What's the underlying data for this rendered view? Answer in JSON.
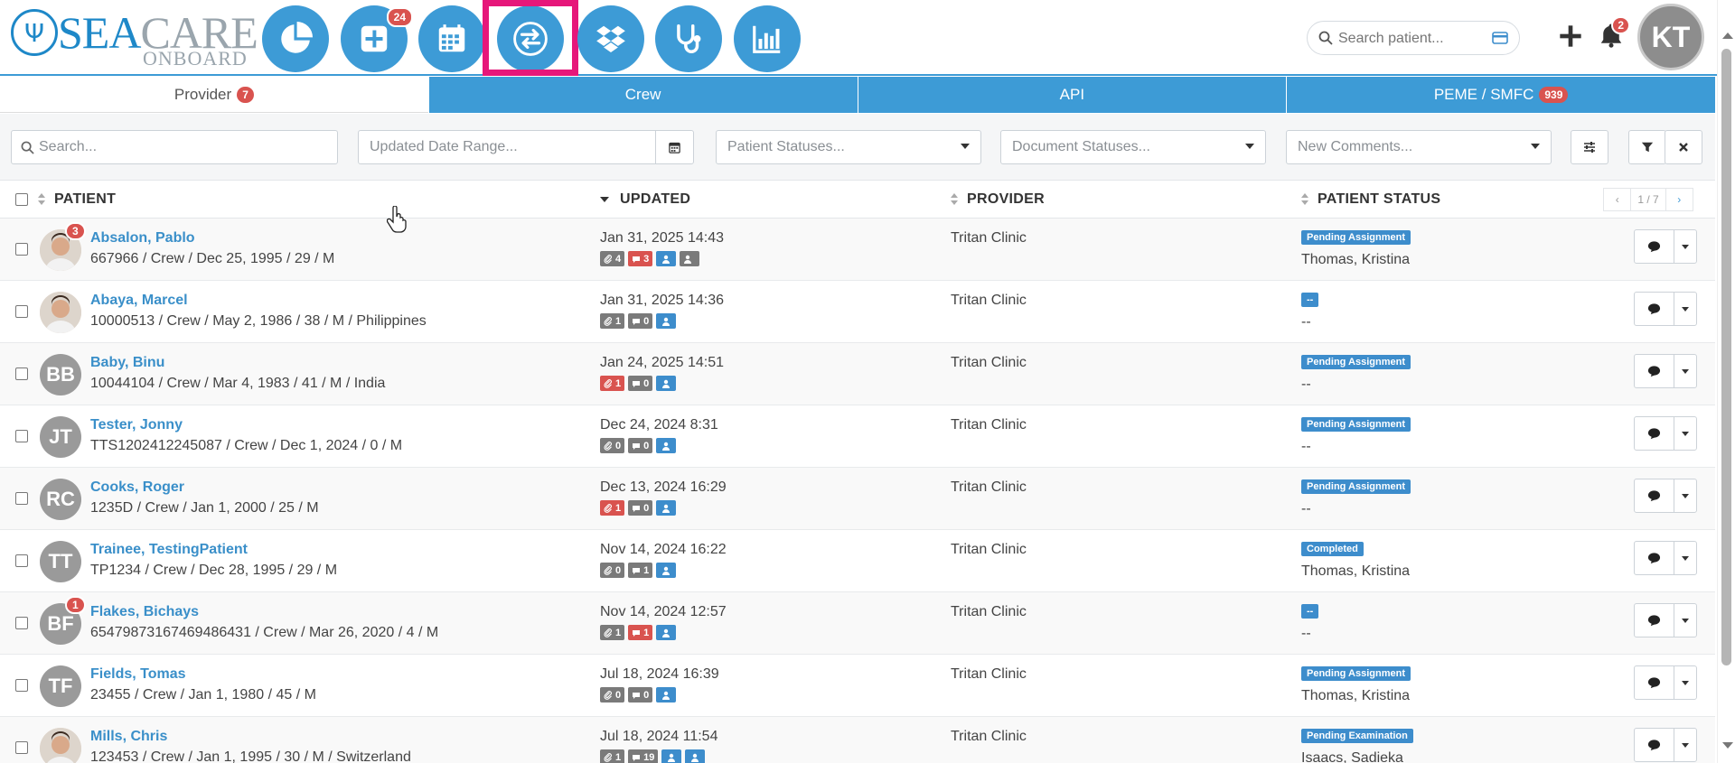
{
  "brand": {
    "name_part1": "SEA",
    "name_part2": "CARE",
    "subtitle": "ONBOARD"
  },
  "nav": [
    {
      "name": "dashboard-pie-icon",
      "badge": ""
    },
    {
      "name": "add-patient-icon",
      "badge": "24"
    },
    {
      "name": "calendar-icon",
      "badge": ""
    },
    {
      "name": "transfer-arrows-icon",
      "badge": ""
    },
    {
      "name": "dropbox-icon",
      "badge": ""
    },
    {
      "name": "stethoscope-icon",
      "badge": ""
    },
    {
      "name": "bar-chart-icon",
      "badge": ""
    }
  ],
  "search": {
    "placeholder": "Search patient..."
  },
  "notifications": {
    "count": "2"
  },
  "user": {
    "initials": "KT"
  },
  "tabs": [
    {
      "label": "Provider",
      "badge": "7",
      "active": true
    },
    {
      "label": "Crew",
      "badge": ""
    },
    {
      "label": "API",
      "badge": ""
    },
    {
      "label": "PEME / SMFC",
      "badge": "939"
    }
  ],
  "filters": {
    "search_placeholder": "Search...",
    "date_placeholder": "Updated Date Range...",
    "patient_status_placeholder": "Patient Statuses...",
    "document_status_placeholder": "Document Statuses...",
    "comments_placeholder": "New Comments..."
  },
  "columns": {
    "patient": "PATIENT",
    "updated": "UPDATED",
    "provider": "PROVIDER",
    "status": "PATIENT STATUS"
  },
  "pagination": {
    "info": "1 / 7",
    "prev": "‹",
    "next": "›"
  },
  "rows": [
    {
      "initials": "",
      "photo": true,
      "badge": "3",
      "name": "Absalon, Pablo",
      "details": "667966 / Crew / Dec 25, 1995 / 29 / M",
      "updated": "Jan 31, 2025 14:43",
      "chips": [
        {
          "type": "grey",
          "icon": "paperclip",
          "count": "4"
        },
        {
          "type": "red",
          "icon": "comment",
          "count": "3"
        },
        {
          "type": "blue",
          "icon": "user",
          "count": ""
        },
        {
          "type": "grey",
          "icon": "user",
          "count": ""
        }
      ],
      "provider": "Tritan Clinic",
      "status": "Pending Assignment",
      "assignee": "Thomas, Kristina"
    },
    {
      "initials": "",
      "photo": true,
      "badge": "",
      "name": "Abaya, Marcel",
      "details": "10000513 / Crew / May 2, 1986 / 38 / M / Philippines",
      "updated": "Jan 31, 2025 14:36",
      "chips": [
        {
          "type": "grey",
          "icon": "paperclip",
          "count": "1"
        },
        {
          "type": "grey",
          "icon": "comment",
          "count": "0"
        },
        {
          "type": "blue",
          "icon": "user",
          "count": ""
        }
      ],
      "provider": "Tritan Clinic",
      "status": "--",
      "assignee": "--"
    },
    {
      "initials": "BB",
      "photo": false,
      "badge": "",
      "name": "Baby, Binu",
      "details": "10044104 / Crew / Mar 4, 1983 / 41 / M / India",
      "updated": "Jan 24, 2025 14:51",
      "chips": [
        {
          "type": "red",
          "icon": "paperclip",
          "count": "1"
        },
        {
          "type": "grey",
          "icon": "comment",
          "count": "0"
        },
        {
          "type": "blue",
          "icon": "user",
          "count": ""
        }
      ],
      "provider": "Tritan Clinic",
      "status": "Pending Assignment",
      "assignee": "--"
    },
    {
      "initials": "JT",
      "photo": false,
      "badge": "",
      "name": "Tester, Jonny",
      "details": "TTS1202412245087 / Crew / Dec 1, 2024 / 0 / M",
      "updated": "Dec 24, 2024 8:31",
      "chips": [
        {
          "type": "grey",
          "icon": "paperclip",
          "count": "0"
        },
        {
          "type": "grey",
          "icon": "comment",
          "count": "0"
        },
        {
          "type": "blue",
          "icon": "user",
          "count": ""
        }
      ],
      "provider": "Tritan Clinic",
      "status": "Pending Assignment",
      "assignee": "--"
    },
    {
      "initials": "RC",
      "photo": false,
      "badge": "",
      "name": "Cooks, Roger",
      "details": "1235D / Crew / Jan 1, 2000 / 25 / M",
      "updated": "Dec 13, 2024 16:29",
      "chips": [
        {
          "type": "red",
          "icon": "paperclip",
          "count": "1"
        },
        {
          "type": "grey",
          "icon": "comment",
          "count": "0"
        },
        {
          "type": "blue",
          "icon": "user",
          "count": ""
        }
      ],
      "provider": "Tritan Clinic",
      "status": "Pending Assignment",
      "assignee": "--"
    },
    {
      "initials": "TT",
      "photo": false,
      "badge": "",
      "name": "Trainee, TestingPatient",
      "details": "TP1234 / Crew / Dec 28, 1995 / 29 / M",
      "updated": "Nov 14, 2024 16:22",
      "chips": [
        {
          "type": "grey",
          "icon": "paperclip",
          "count": "0"
        },
        {
          "type": "grey",
          "icon": "comment",
          "count": "1"
        },
        {
          "type": "blue",
          "icon": "user",
          "count": ""
        }
      ],
      "provider": "Tritan Clinic",
      "status": "Completed",
      "assignee": "Thomas, Kristina"
    },
    {
      "initials": "BF",
      "photo": false,
      "badge": "1",
      "name": "Flakes, Bichays",
      "details": "65479873167469486431 / Crew / Mar 26, 2020 / 4 / M",
      "updated": "Nov 14, 2024 12:57",
      "chips": [
        {
          "type": "grey",
          "icon": "paperclip",
          "count": "1"
        },
        {
          "type": "red",
          "icon": "comment",
          "count": "1"
        },
        {
          "type": "blue",
          "icon": "user",
          "count": ""
        }
      ],
      "provider": "Tritan Clinic",
      "status": "--",
      "assignee": "--"
    },
    {
      "initials": "TF",
      "photo": false,
      "badge": "",
      "name": "Fields, Tomas",
      "details": "23455 / Crew / Jan 1, 1980 / 45 / M",
      "updated": "Jul 18, 2024 16:39",
      "chips": [
        {
          "type": "grey",
          "icon": "paperclip",
          "count": "0"
        },
        {
          "type": "grey",
          "icon": "comment",
          "count": "0"
        },
        {
          "type": "blue",
          "icon": "user",
          "count": ""
        }
      ],
      "provider": "Tritan Clinic",
      "status": "Pending Assignment",
      "assignee": "Thomas, Kristina"
    },
    {
      "initials": "",
      "photo": true,
      "badge": "",
      "name": "Mills, Chris",
      "details": "123453 / Crew / Jan 1, 1995 / 30 / M / Switzerland",
      "updated": "Jul 18, 2024 11:54",
      "chips": [
        {
          "type": "grey",
          "icon": "paperclip",
          "count": "1"
        },
        {
          "type": "grey",
          "icon": "comment",
          "count": "19"
        },
        {
          "type": "blue",
          "icon": "user",
          "count": ""
        },
        {
          "type": "blue",
          "icon": "user",
          "count": ""
        }
      ],
      "provider": "Tritan Clinic",
      "status": "Pending Examination",
      "assignee": "Isaacs, Sadieka"
    }
  ],
  "colors": {
    "primary": "#3d9bd6",
    "link": "#3a8fc9",
    "badge_red": "#d9534f",
    "highlight": "#e6177a"
  }
}
